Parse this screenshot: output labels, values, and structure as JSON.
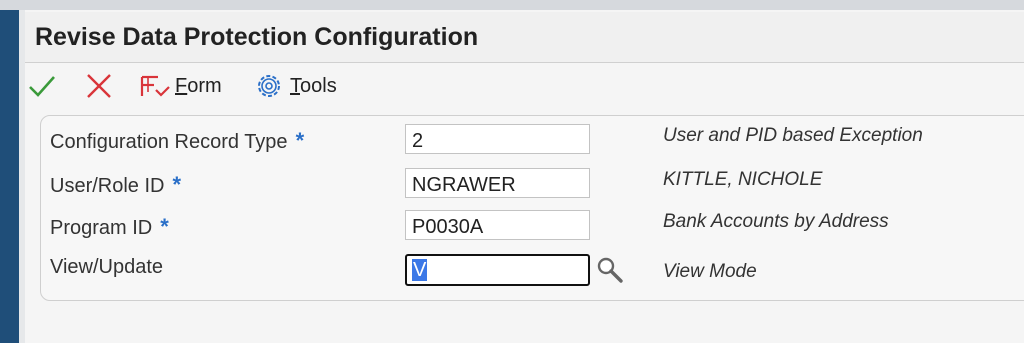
{
  "window": {
    "title": "Revise Data Protection Configuration"
  },
  "toolbar": {
    "ok_icon": "check-icon",
    "cancel_icon": "close-icon",
    "form_menu": {
      "access_key": "F",
      "rest": "orm",
      "icon": "form-icon"
    },
    "tools_menu": {
      "access_key": "T",
      "rest": "ools",
      "icon": "gear-icon"
    }
  },
  "form": {
    "fields": [
      {
        "label": "Configuration Record Type",
        "required_mark": "*",
        "value": "2",
        "description": "User and PID based Exception"
      },
      {
        "label": "User/Role ID",
        "required_mark": "*",
        "value": "NGRAWER",
        "description": "KITTLE, NICHOLE"
      },
      {
        "label": "Program ID",
        "required_mark": "*",
        "value": "P0030A",
        "description": "Bank Accounts by Address"
      },
      {
        "label": "View/Update",
        "value": "V",
        "description": "View Mode",
        "visual_assist_icon": "search-icon"
      }
    ]
  },
  "colors": {
    "accent_blue": "#2a6fc8",
    "ok_green": "#3a9a3a",
    "cancel_red": "#d9343a",
    "nav_bar": "#1f4e79"
  }
}
